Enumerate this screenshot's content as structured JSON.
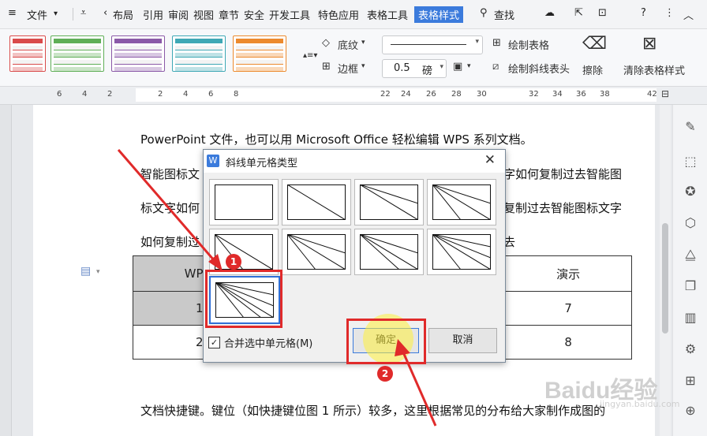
{
  "menubar": {
    "file_label": "文件",
    "tabs": [
      "布局",
      "引用",
      "审阅",
      "视图",
      "章节",
      "安全",
      "开发工具",
      "特色应用",
      "表格工具"
    ],
    "active_tab": "表格样式",
    "search_label": "查找"
  },
  "ribbon": {
    "shading_label": "底纹",
    "border_label": "边框",
    "line_width_value": "0.5",
    "line_width_unit": "磅",
    "draw_table_label": "绘制表格",
    "draw_diagonal_label": "绘制斜线表头",
    "erase_label": "擦除",
    "clear_style_label": "清除表格样式",
    "swatch_colors": [
      "#d94b4b",
      "#5fae57",
      "#8b5aa8",
      "#3fa8b5",
      "#ec8a2e"
    ]
  },
  "ruler": {
    "numbers": [
      "6",
      "4",
      "2",
      "2",
      "4",
      "6",
      "8",
      "22",
      "24",
      "26",
      "28",
      "30",
      "32",
      "34",
      "36",
      "38",
      "42"
    ]
  },
  "document": {
    "line1": "PowerPoint 文件，也可以用 Microsoft Office 轻松编辑 WPS 系列文档。",
    "line2_left": "智能图标文",
    "line2_right": "字如何复制过去智能图",
    "line3_left": "标文字如何",
    "line3_right": "复制过去智能图标文字",
    "line4_left": "如何复制过",
    "line4_right": "去",
    "table": {
      "header_left": "WP",
      "header_right": "演示",
      "rows": [
        {
          "left": "1",
          "right": "7"
        },
        {
          "left": "2",
          "right": "8"
        }
      ]
    },
    "bottom_line": "文档快捷键。键位（如快捷键位图 1 所示）较多，这里根据常见的分布给大家制作成图的"
  },
  "dialog": {
    "title": "斜线单元格类型",
    "merge_label": "合并选中单元格(M)",
    "merge_checked": true,
    "ok_label": "确定",
    "cancel_label": "取消"
  },
  "annotations": {
    "badge1": "1",
    "badge2": "2"
  },
  "watermark": {
    "brand": "Baidu",
    "tail": "经验",
    "sub": "jingyan.baidu.com"
  }
}
